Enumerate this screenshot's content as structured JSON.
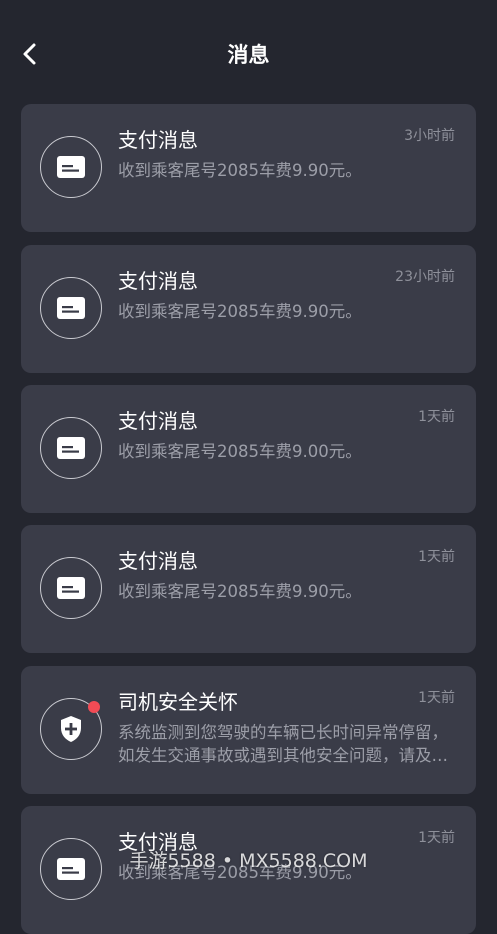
{
  "header": {
    "title": "消息",
    "back_icon": "chevron-left-icon"
  },
  "colors": {
    "background": "#24262f",
    "card": "#3a3c48",
    "unread_dot": "#f24b55"
  },
  "messages": [
    {
      "icon": "card-icon",
      "title": "支付消息",
      "time": "3小时前",
      "body": "收到乘客尾号2085车费9.90元。",
      "unread": false
    },
    {
      "icon": "card-icon",
      "title": "支付消息",
      "time": "23小时前",
      "body": "收到乘客尾号2085车费9.90元。",
      "unread": false
    },
    {
      "icon": "card-icon",
      "title": "支付消息",
      "time": "1天前",
      "body": "收到乘客尾号2085车费9.00元。",
      "unread": false
    },
    {
      "icon": "card-icon",
      "title": "支付消息",
      "time": "1天前",
      "body": "收到乘客尾号2085车费9.90元。",
      "unread": false
    },
    {
      "icon": "shield-plus-icon",
      "title": "司机安全关怀",
      "time": "1天前",
      "body": "系统监测到您驾驶的车辆已长时间异常停留，如发生交通事故或遇到其他安全问题，请及时联系客服。",
      "unread": true
    },
    {
      "icon": "card-icon",
      "title": "支付消息",
      "time": "1天前",
      "body": "收到乘客尾号2085车费9.90元。",
      "unread": false
    }
  ],
  "watermark": "手游5588 • MX5588.COM"
}
